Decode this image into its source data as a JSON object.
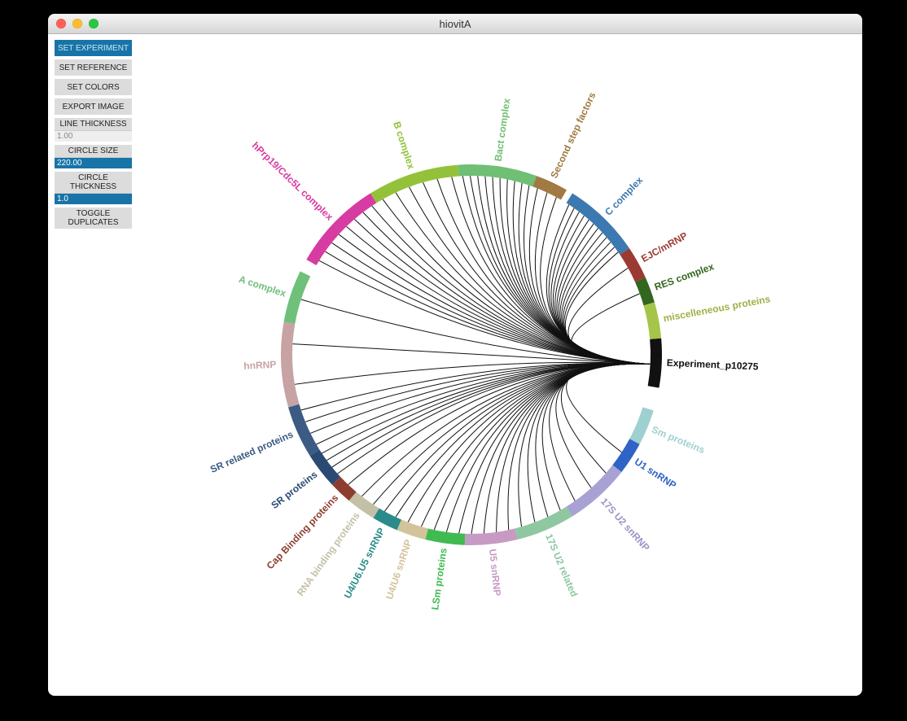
{
  "window": {
    "title": "hiovitA"
  },
  "sidebar": {
    "set_experiment": "SET EXPERIMENT",
    "set_reference": "SET REFERENCE",
    "set_colors": "SET COLORS",
    "export_image": "EXPORT IMAGE",
    "line_thickness_label": "LINE THICKNESS",
    "line_thickness_value": "1.00",
    "circle_size_label": "CIRCLE SIZE",
    "circle_size_value": "220.00",
    "circle_thickness_label": "CIRCLE THICKNESS",
    "circle_thickness_value": "1.0",
    "toggle_duplicates": "TOGGLE\nDUPLICATES"
  },
  "chart_data": {
    "type": "chord",
    "title": "",
    "hub": {
      "label": "Experiment_p10275",
      "angle": 3
    },
    "ring": {
      "radius": 220,
      "thickness": 14
    },
    "colors": {
      "arc_default": "#999",
      "chord": "#111"
    },
    "arcs": [
      {
        "id": "exp",
        "label": "Experiment_p10275",
        "start": -5,
        "end": 10,
        "color": "#111111",
        "text_color": "#111111"
      },
      {
        "id": "sm",
        "label": "Sm proteins",
        "start": 17,
        "end": 28,
        "color": "#9fd0d0",
        "text_color": "#9fd0d0"
      },
      {
        "id": "u1",
        "label": "U1 snRNP",
        "start": 28,
        "end": 38,
        "color": "#2f63c7",
        "text_color": "#2f63c7"
      },
      {
        "id": "u2_17s",
        "label": "17S U2 snRNP",
        "start": 38,
        "end": 58,
        "color": "#a7a1d4",
        "text_color": "#9a94c6"
      },
      {
        "id": "u2_17s_rel",
        "label": "17S U2 related",
        "start": 58,
        "end": 76,
        "color": "#8fc7a1",
        "text_color": "#8fc7a1"
      },
      {
        "id": "u5",
        "label": "U5 snRNP",
        "start": 76,
        "end": 92,
        "color": "#c79ac4",
        "text_color": "#c79ac4"
      },
      {
        "id": "lsm",
        "label": "LSm proteins",
        "start": 92,
        "end": 104,
        "color": "#3fbb52",
        "text_color": "#3fbb52"
      },
      {
        "id": "u4u6",
        "label": "U4/U6 snRNP",
        "start": 104,
        "end": 113,
        "color": "#d3c39a",
        "text_color": "#d3c39a"
      },
      {
        "id": "u4u6u5",
        "label": "U4/U6.U5 snRNP",
        "start": 113,
        "end": 121,
        "color": "#2b8b8a",
        "text_color": "#2b8b8a"
      },
      {
        "id": "rnabp",
        "label": "RNA binding proteins",
        "start": 121,
        "end": 130,
        "color": "#c4bfa7",
        "text_color": "#c4bfa7"
      },
      {
        "id": "capbp",
        "label": "Cap Binding proteins",
        "start": 130,
        "end": 137,
        "color": "#8d3d2f",
        "text_color": "#8d3d2f"
      },
      {
        "id": "srprot",
        "label": "SR proteins",
        "start": 137,
        "end": 148,
        "color": "#2a4a74",
        "text_color": "#2a4a74"
      },
      {
        "id": "srrel",
        "label": "SR related proteins",
        "start": 148,
        "end": 164,
        "color": "#3b5b85",
        "text_color": "#3b5b85"
      },
      {
        "id": "hnrnp",
        "label": "hnRNP",
        "start": 164,
        "end": 190,
        "color": "#c7a3a4",
        "text_color": "#c7a3a4"
      },
      {
        "id": "acomplex",
        "label": "A complex",
        "start": 190,
        "end": 206,
        "color": "#6fc07a",
        "text_color": "#6fc07a"
      },
      {
        "id": "hprp19",
        "label": "hPrp19/Cdc5L complex",
        "start": 210,
        "end": 238,
        "color": "#d63ca1",
        "text_color": "#d63ca1"
      },
      {
        "id": "bcomplex",
        "label": "B complex",
        "start": 238,
        "end": 266,
        "color": "#93c23a",
        "text_color": "#93c23a"
      },
      {
        "id": "bact",
        "label": "Bact complex",
        "start": 266,
        "end": 290,
        "color": "#6fbf74",
        "text_color": "#6fbf74"
      },
      {
        "id": "secondstep",
        "label": "Second step factors",
        "start": 290,
        "end": 300,
        "color": "#a07a42",
        "text_color": "#a07a42"
      },
      {
        "id": "ccomplex",
        "label": "C complex",
        "start": 302,
        "end": 326,
        "color": "#3c79b0",
        "text_color": "#3c79b0"
      },
      {
        "id": "ejc",
        "label": "EJC/mRNP",
        "start": 326,
        "end": 336,
        "color": "#9a3a33",
        "text_color": "#9a3a33"
      },
      {
        "id": "res",
        "label": "RES complex",
        "start": 336,
        "end": 344,
        "color": "#33661f",
        "text_color": "#33661f"
      },
      {
        "id": "misc",
        "label": "miscelleneous proteins",
        "start": 344,
        "end": 355,
        "color": "#a4c54a",
        "text_color": "#9eb044"
      }
    ],
    "chords": [
      {
        "to": "ccomplex",
        "count": 12
      },
      {
        "to": "bact",
        "count": 10
      },
      {
        "to": "secondstep",
        "count": 3
      },
      {
        "to": "bcomplex",
        "count": 6
      },
      {
        "to": "hprp19",
        "count": 8
      },
      {
        "to": "acomplex",
        "count": 1
      },
      {
        "to": "hnrnp",
        "count": 2
      },
      {
        "to": "srrel",
        "count": 4
      },
      {
        "to": "srprot",
        "count": 4
      },
      {
        "to": "capbp",
        "count": 1
      },
      {
        "to": "rnabp",
        "count": 2
      },
      {
        "to": "u4u6u5",
        "count": 2
      },
      {
        "to": "u4u6",
        "count": 2
      },
      {
        "to": "lsm",
        "count": 3
      },
      {
        "to": "u5",
        "count": 4
      },
      {
        "to": "u2_17s_rel",
        "count": 4
      },
      {
        "to": "u2_17s",
        "count": 3
      },
      {
        "to": "u1",
        "count": 1
      },
      {
        "to": "ejc",
        "count": 1
      },
      {
        "to": "res",
        "count": 1
      }
    ]
  }
}
